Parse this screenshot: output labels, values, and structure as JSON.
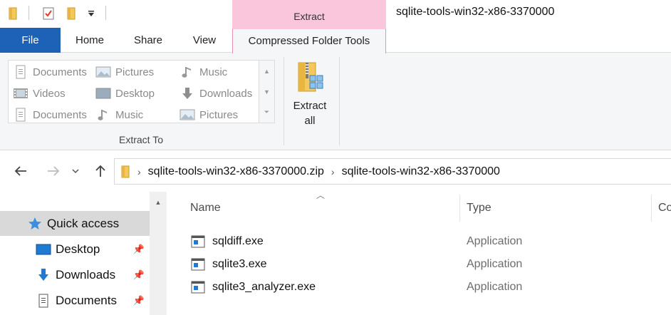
{
  "titlebar": {
    "context_tab_header": "Extract",
    "window_title": "sqlite-tools-win32-x86-3370000",
    "quick_access_toolbar": [
      "folder-icon",
      "properties-check-icon",
      "new-folder-icon",
      "customize-dropdown-icon"
    ]
  },
  "ribbon_tabs": [
    {
      "label": "File",
      "active": false
    },
    {
      "label": "Home",
      "active": false
    },
    {
      "label": "Share",
      "active": false
    },
    {
      "label": "View",
      "active": false
    },
    {
      "label": "Compressed Folder Tools",
      "active": true
    }
  ],
  "extract_to": {
    "group_label": "Extract To",
    "destinations": [
      {
        "label": "Documents",
        "icon": "documents-icon"
      },
      {
        "label": "Pictures",
        "icon": "pictures-icon"
      },
      {
        "label": "Music",
        "icon": "music-icon"
      },
      {
        "label": "Videos",
        "icon": "videos-icon"
      },
      {
        "label": "Desktop",
        "icon": "desktop-icon"
      },
      {
        "label": "Downloads",
        "icon": "downloads-icon"
      },
      {
        "label": "Documents",
        "icon": "documents-icon"
      },
      {
        "label": "Music",
        "icon": "music-icon"
      },
      {
        "label": "Pictures",
        "icon": "pictures-icon"
      }
    ]
  },
  "extract_all": {
    "line1": "Extract",
    "line2": "all"
  },
  "address_bar": {
    "path": [
      "sqlite-tools-win32-x86-3370000.zip",
      "sqlite-tools-win32-x86-3370000"
    ]
  },
  "nav_pane": {
    "items": [
      {
        "label": "Quick access",
        "icon": "star-icon",
        "selected": true,
        "pinned": false
      },
      {
        "label": "Desktop",
        "icon": "desktop-icon",
        "selected": false,
        "pinned": true
      },
      {
        "label": "Downloads",
        "icon": "downloads-icon",
        "selected": false,
        "pinned": true
      },
      {
        "label": "Documents",
        "icon": "documents-icon",
        "selected": false,
        "pinned": true
      }
    ]
  },
  "file_list": {
    "columns": [
      "Name",
      "Type",
      "Co"
    ],
    "files": [
      {
        "name": "sqldiff.exe",
        "type": "Application",
        "icon": "application-icon"
      },
      {
        "name": "sqlite3.exe",
        "type": "Application",
        "icon": "application-icon"
      },
      {
        "name": "sqlite3_analyzer.exe",
        "type": "Application",
        "icon": "application-icon"
      }
    ]
  },
  "colors": {
    "file_tab_blue": "#1e62b8",
    "context_tab_pink": "#f9c6dc",
    "selected_gray": "#d9d9d9",
    "accent_blue": "#1e7ad2"
  }
}
